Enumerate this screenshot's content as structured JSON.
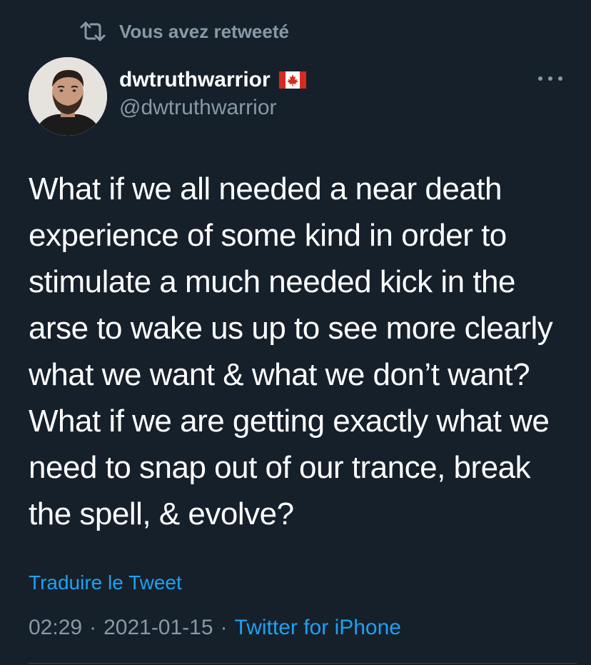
{
  "retweet_banner": {
    "icon": "retweet-icon",
    "label": "Vous avez retweeté"
  },
  "author": {
    "avatar": "avatar",
    "display_name": "dwtruthwarrior",
    "flag_icon": "canada-flag-icon",
    "handle": "@dwtruthwarrior"
  },
  "more_menu": {
    "icon": "more-options-icon"
  },
  "tweet": {
    "text": "What if we all needed a near death\nexperience of some kind in order to\nstimulate a much needed kick in the\narse to wake us up to see more clearly\nwhat we want & what we don’t want?\nWhat if we are getting exactly what we\nneed to snap out of our trance, break\nthe spell, & evolve?",
    "translate_label": "Traduire le Tweet",
    "time": "02:29",
    "date": "2021-01-15",
    "separator": "·",
    "source": "Twitter for iPhone"
  },
  "colors": {
    "background": "#15202b",
    "secondary_text": "#8899a6",
    "link": "#1da1f2",
    "primary_text": "#ffffff"
  }
}
